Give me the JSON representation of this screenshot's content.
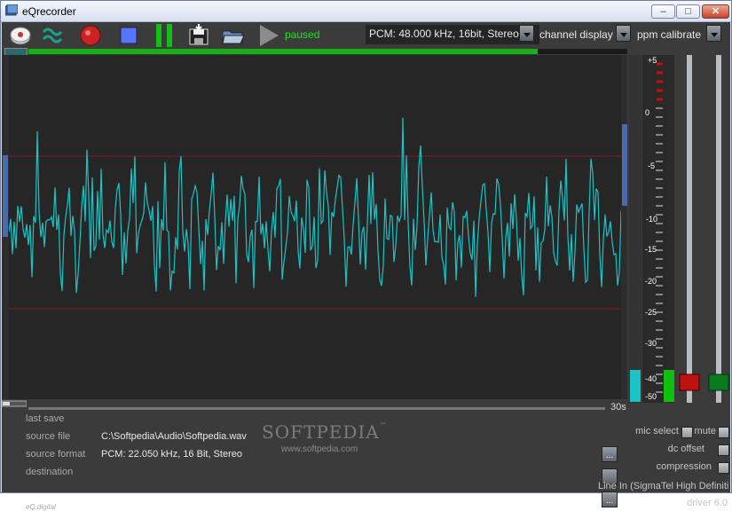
{
  "window": {
    "title": "eQrecorder",
    "minimize_label": "–",
    "maximize_label": "□",
    "close_label": "✕"
  },
  "toolbar": {
    "status": "paused",
    "format": "PCM: 48.000 kHz, 16bit, Stereo",
    "channel_display_label": "channel display",
    "ppm_calibrate_label": "ppm calibrate",
    "progress": 0.85,
    "icons": [
      "disk-icon",
      "wave-icon",
      "record-icon",
      "stop-icon",
      "pause-icon",
      "save-icon",
      "open-folder-icon",
      "play-icon"
    ]
  },
  "scope": {
    "time_end_label": "30s",
    "reference_line_color": "#8b1a1a",
    "waveform_color": "#19c3c6"
  },
  "meter": {
    "scale": [
      "+5",
      "0",
      "-5",
      "-10",
      "-15",
      "-20",
      "-25",
      "-30",
      "-40",
      "-50"
    ],
    "bar_colors": {
      "cyan": "#19c3c6",
      "green": "#10c010",
      "red": "#c01010",
      "dark_green": "#0a7a1a"
    }
  },
  "info": {
    "last_save_label": "last save",
    "last_save_value": "",
    "source_file_label": "source file",
    "source_file_value": "C:\\Softpedia\\Audio\\Softpedia.wav",
    "source_format_label": "source format",
    "source_format_value": "PCM: 22.050 kHz, 16 Bit, Stereo",
    "destination_label": "destination",
    "destination_value": "",
    "brand": "eQ.digital",
    "ellipsis": "..."
  },
  "options": {
    "mic_select_label": "mic select",
    "mute_label": "mute",
    "dc_offset_label": "dc offset",
    "compression_label": "compression",
    "line_in_label": "Line In (SigmaTel High Definiti",
    "driver_label": "driver 6.0"
  },
  "watermark": {
    "main": "SOFTPEDIA",
    "tm": "™",
    "url": "www.softpedia.com"
  }
}
